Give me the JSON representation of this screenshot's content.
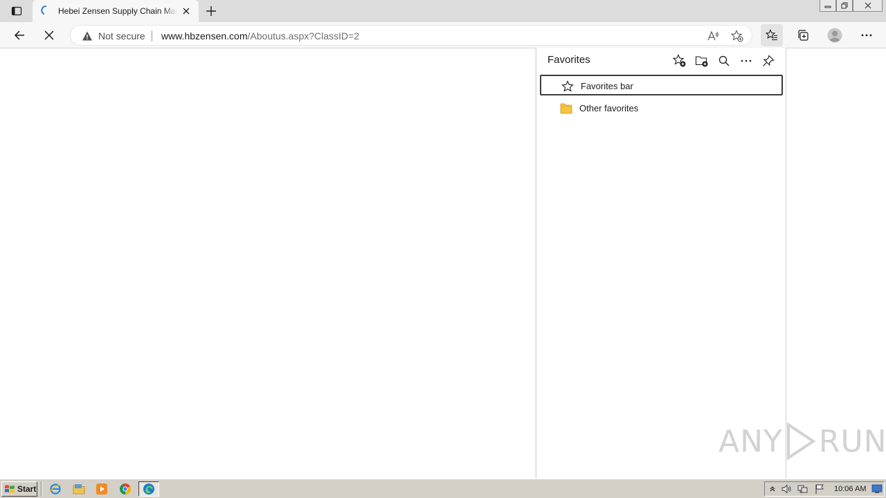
{
  "tab": {
    "title": "Hebei Zensen Supply Chain Management"
  },
  "toolbar": {
    "security_label": "Not secure",
    "url_host": "www.hbzensen.com",
    "url_path": "/Aboutus.aspx?ClassID=2"
  },
  "favorites": {
    "title": "Favorites",
    "items": [
      {
        "label": "Favorites bar",
        "icon": "star-outline-icon",
        "selected": true
      },
      {
        "label": "Other favorites",
        "icon": "folder-icon",
        "selected": false
      }
    ]
  },
  "watermark": {
    "left_text": "ANY",
    "right_text": "RUN"
  },
  "taskbar": {
    "start_label": "Start",
    "clock": "10:06 AM",
    "pinned": [
      "internet-explorer-icon",
      "file-explorer-icon",
      "media-player-icon",
      "chrome-icon",
      "edge-icon"
    ]
  },
  "colors": {
    "tabstrip": "#dcdcdc",
    "toolbar": "#f7f7f7",
    "taskbar": "#d4d0c8",
    "folder": "#f4c542",
    "edge_blue": "#1f7ad2"
  }
}
